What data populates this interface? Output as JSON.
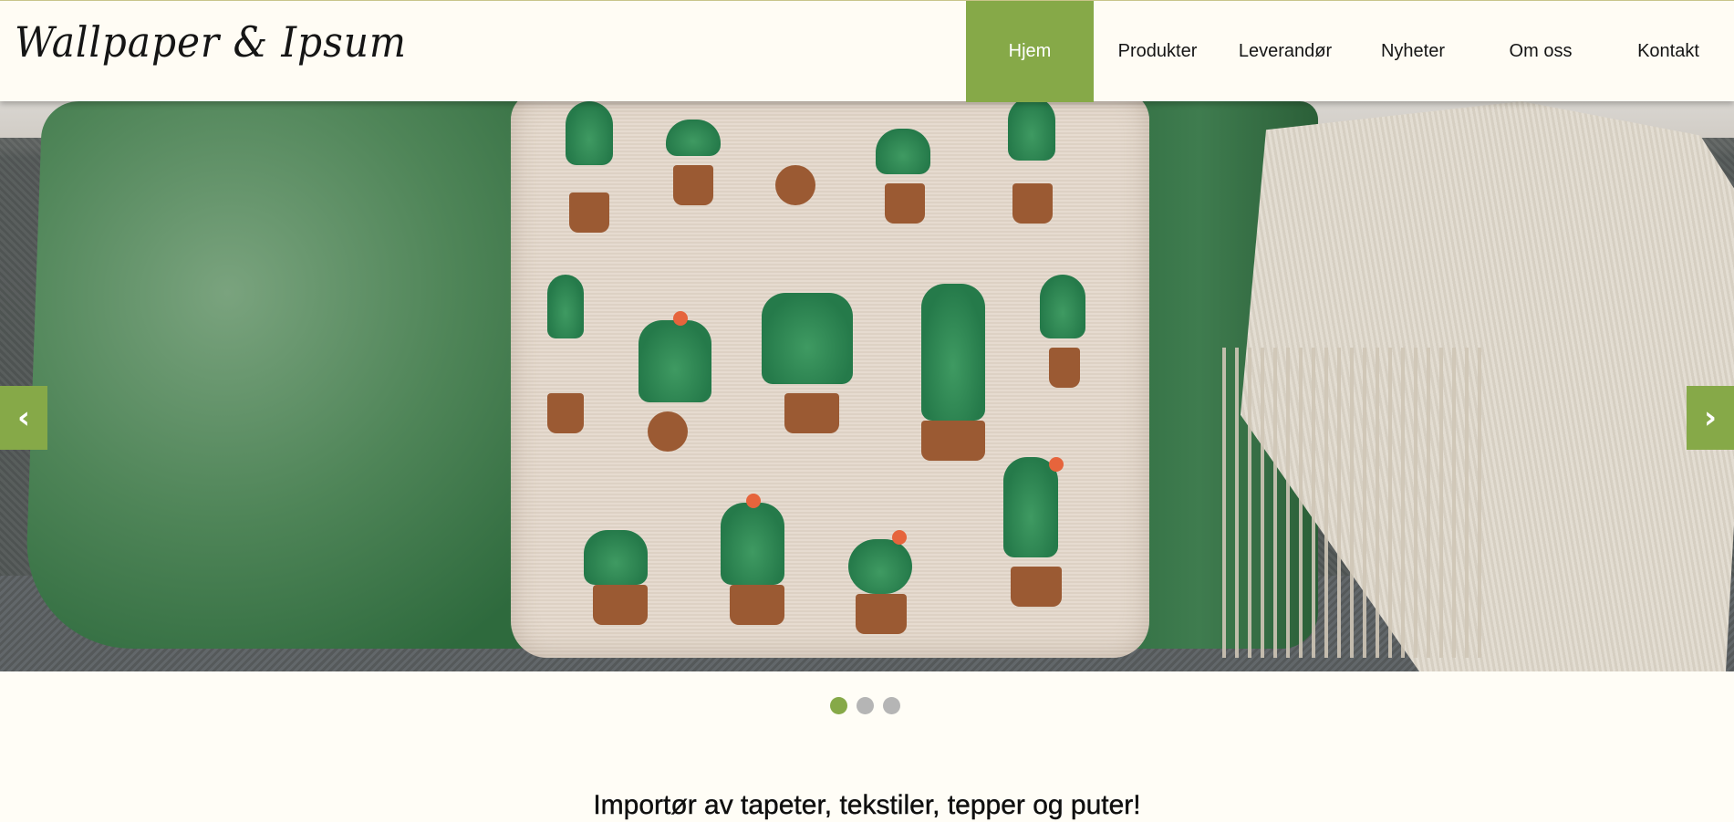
{
  "header": {
    "logo_text": "Wallpaper & Ipsum",
    "nav": [
      {
        "label": "Hjem",
        "active": true
      },
      {
        "label": "Produkter",
        "active": false
      },
      {
        "label": "Leverandør",
        "active": false
      },
      {
        "label": "Nyheter",
        "active": false
      },
      {
        "label": "Om oss",
        "active": false
      },
      {
        "label": "Kontakt",
        "active": false
      }
    ]
  },
  "slider": {
    "prev_label": "‹",
    "next_label": "›",
    "dots": [
      true,
      false,
      false
    ],
    "image": "sofa with green velvet pillows, cactus-print pillow and knitted throw"
  },
  "main": {
    "tagline": "Importør av tapeter, tekstiler, tepper og puter!"
  },
  "colors": {
    "accent": "#86a948",
    "background": "#fffdf6",
    "dot_inactive": "#b5b5b5"
  }
}
